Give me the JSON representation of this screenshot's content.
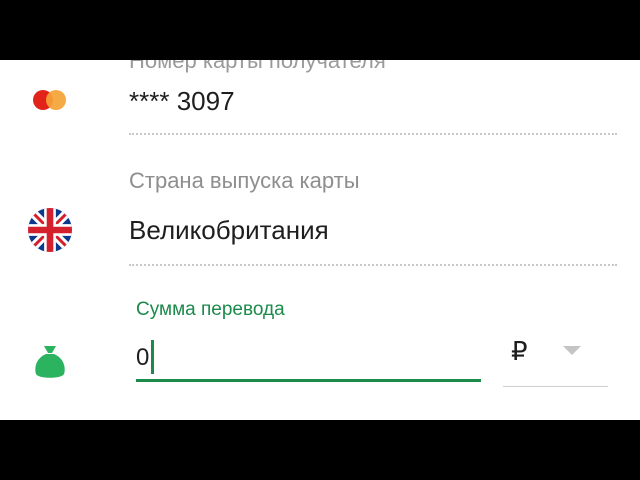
{
  "card": {
    "header_label_partial": "Номер карты получателя",
    "icon": "mastercard-icon",
    "number": "**** 3097"
  },
  "country": {
    "label": "Страна выпуска карты",
    "icon": "uk-flag-icon",
    "value": "Великобритания"
  },
  "amount": {
    "label": "Сумма перевода",
    "icon": "money-bag-icon",
    "value": "0"
  },
  "currency": {
    "value": "₽"
  },
  "colors": {
    "accent": "#1b8a4b",
    "mastercard_red": "#e2231a",
    "mastercard_orange": "#f4a336"
  }
}
